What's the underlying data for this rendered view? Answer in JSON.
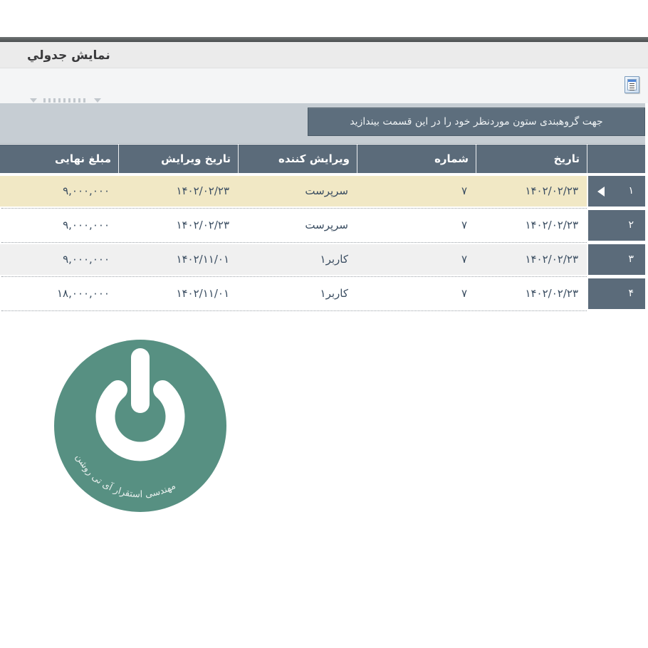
{
  "window": {
    "title": "نمايش جدولي"
  },
  "toolbar": {
    "column_chooser_icon": "column-chooser"
  },
  "group_panel": {
    "hint": "جهت گروهبندی ستون موردنظر خود را در این قسمت بیندازید"
  },
  "table": {
    "columns": [
      "تاریخ",
      "شماره",
      "ویرایش کننده",
      "تاریخ ویرایش",
      "مبلغ نهایی"
    ],
    "rows": [
      {
        "num": "۱",
        "date": "۱۴۰۲/۰۲/۲۳",
        "number": "۷",
        "editor": "سرپرست",
        "edit_date": "۱۴۰۲/۰۲/۲۳",
        "amount": "۹,۰۰۰,۰۰۰",
        "selected": true
      },
      {
        "num": "۲",
        "date": "۱۴۰۲/۰۲/۲۳",
        "number": "۷",
        "editor": "سرپرست",
        "edit_date": "۱۴۰۲/۰۲/۲۳",
        "amount": "۹,۰۰۰,۰۰۰",
        "selected": false
      },
      {
        "num": "۳",
        "date": "۱۴۰۲/۰۲/۲۳",
        "number": "۷",
        "editor": "کاربر۱",
        "edit_date": "۱۴۰۲/۱۱/۰۱",
        "amount": "۹,۰۰۰,۰۰۰",
        "selected": false
      },
      {
        "num": "۴",
        "date": "۱۴۰۲/۰۲/۲۳",
        "number": "۷",
        "editor": "کاربر۱",
        "edit_date": "۱۴۰۲/۱۱/۰۱",
        "amount": "۱۸,۰۰۰,۰۰۰",
        "selected": false
      }
    ]
  },
  "watermark": {
    "text": "مهندسی استقرار آی تی روشن"
  },
  "colors": {
    "header_bg": "#5b6b7a",
    "group_panel_bg": "#c6cdd3",
    "hint_box_bg": "#5d6e7d",
    "selected_row_bg": "#f1e8c5",
    "alt_row_bg": "#f0f0f0",
    "cell_text": "#3a4d61",
    "logo_teal": "#579082",
    "top_bar": "#4c5051"
  }
}
